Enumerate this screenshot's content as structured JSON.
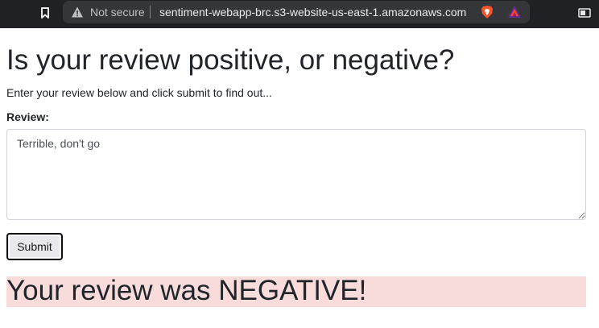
{
  "browser": {
    "security_label": "Not secure",
    "url": "sentiment-webapp-brc.s3-website-us-east-1.amazonaws.com"
  },
  "page": {
    "title": "Is your review positive, or negative?",
    "instructions": "Enter your review below and click submit to find out...",
    "review_label": "Review:",
    "review_value": "Terrible, don't go",
    "submit_label": "Submit",
    "result_text": "Your review was NEGATIVE!",
    "result_background": "#f8dcdc"
  },
  "icons": {
    "bookmark": "bookmark-icon",
    "warning": "warning-icon",
    "brave": "brave-shield-icon",
    "rewards": "brave-rewards-icon",
    "extensions": "extensions-icon"
  }
}
